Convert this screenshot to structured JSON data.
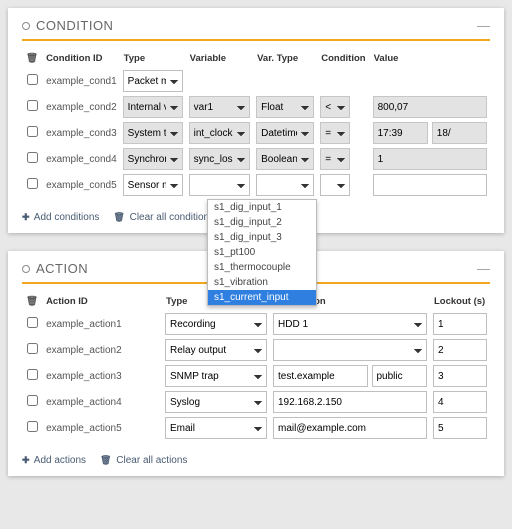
{
  "condition": {
    "title": "CONDITION",
    "headers": [
      "Condition ID",
      "Type",
      "Variable",
      "Var. Type",
      "Condition",
      "Value"
    ],
    "rows": [
      {
        "id": "example_cond1",
        "type": "Packet m",
        "gray": false,
        "var": "",
        "vartype": "",
        "cond": "",
        "val_a": "",
        "val_b": ""
      },
      {
        "id": "example_cond2",
        "type": "Internal v",
        "gray": true,
        "var": "var1",
        "vartype": "Float",
        "cond": "<",
        "val_a": "800,07",
        "val_b": null
      },
      {
        "id": "example_cond3",
        "type": "System ti",
        "gray": true,
        "var": "int_clock",
        "vartype": "Datetime",
        "cond": "=",
        "val_a": "17:39",
        "val_b": "18/"
      },
      {
        "id": "example_cond4",
        "type": "Synchron",
        "gray": true,
        "var": "sync_loss",
        "vartype": "Boolean",
        "cond": "=",
        "val_a": "1",
        "val_b": null
      },
      {
        "id": "example_cond5",
        "type": "Sensor m",
        "gray": false,
        "var": "",
        "vartype": "",
        "cond": "",
        "val_a": "",
        "val_b": null
      }
    ],
    "dropdown_options": [
      "s1_dig_input_1",
      "s1_dig_input_2",
      "s1_dig_input_3",
      "s1_pt100",
      "s1_thermocouple",
      "s1_vibration",
      "s1_current_input"
    ],
    "dropdown_selected_index": 6,
    "footer": {
      "add": "Add conditions",
      "clear": "Clear all conditions"
    }
  },
  "action": {
    "title": "ACTION",
    "headers": [
      "Action ID",
      "Type",
      "Destination",
      "Lockout (s)"
    ],
    "rows": [
      {
        "id": "example_action1",
        "type": "Recording",
        "dest": "HDD 1",
        "dest_is_select": true,
        "lock": "1"
      },
      {
        "id": "example_action2",
        "type": "Relay output",
        "dest": "",
        "dest_is_select": true,
        "lock": "2"
      },
      {
        "id": "example_action3",
        "type": "SNMP trap",
        "dest": "test.example",
        "dest2": "public",
        "lock": "3"
      },
      {
        "id": "example_action4",
        "type": "Syslog",
        "dest": "192.168.2.150",
        "lock": "4"
      },
      {
        "id": "example_action5",
        "type": "Email",
        "dest": "mail@example.com",
        "lock": "5"
      }
    ],
    "footer": {
      "add": "Add actions",
      "clear": "Clear all actions"
    }
  }
}
